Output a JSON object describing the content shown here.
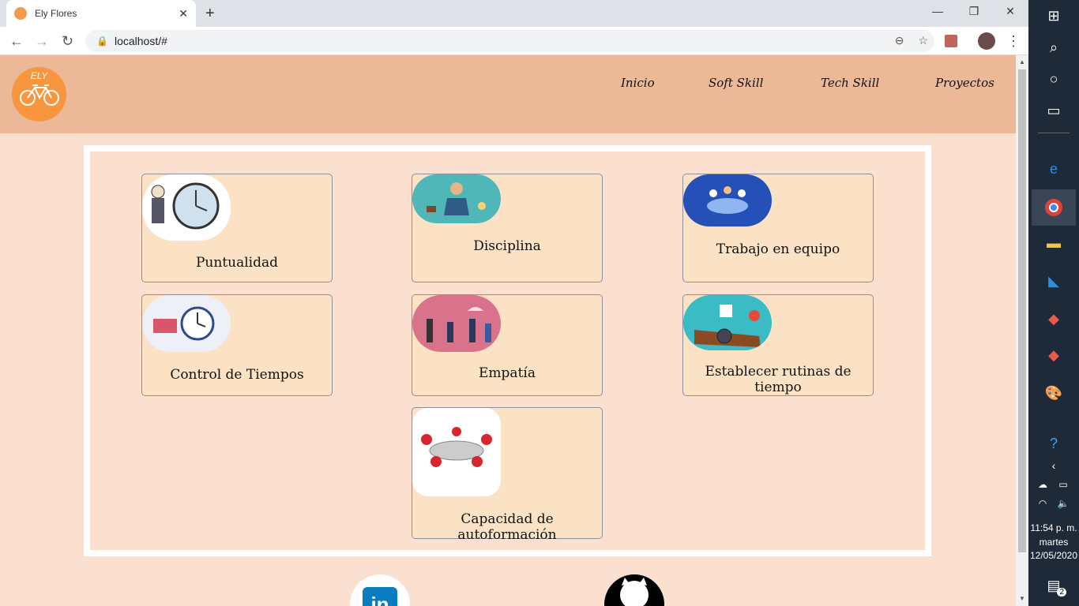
{
  "browser": {
    "tab_title": "Ely Flores",
    "tab_close": "✕",
    "new_tab": "+",
    "url": "localhost/#",
    "window_controls": [
      "—",
      "❐",
      "✕"
    ]
  },
  "header": {
    "logo_text": "ELY",
    "nav": [
      "Inicio",
      "Soft Skill",
      "Tech Skill",
      "Proyectos"
    ]
  },
  "cards": [
    {
      "label": "Puntualidad",
      "icon": "clock-cartoon-image"
    },
    {
      "label": "Disciplina",
      "icon": "meditation-image"
    },
    {
      "label": "Trabajo en equipo",
      "icon": "team-meeting-image"
    },
    {
      "label": "Control de Tiempos",
      "icon": "time-control-image"
    },
    {
      "label": "Empatía",
      "icon": "people-umbrella-image"
    },
    {
      "label": "Establecer rutinas de tiempo",
      "icon": "wristwatch-image"
    },
    {
      "label": "Capacidad de autoformación",
      "icon": "red-figures-table-image"
    }
  ],
  "footer": {
    "social": [
      "linkedin-icon",
      "github-icon"
    ],
    "linkedin_text": "in"
  },
  "taskbar": {
    "time": "11:54 p. m.",
    "day": "martes",
    "date": "12/05/2020",
    "notifications": "2"
  },
  "colors": {
    "header_bg": "#ebb898",
    "page_bg": "#fbe0d0",
    "card_bg": "#fbe2c4",
    "logo_bg": "#f8953f"
  }
}
